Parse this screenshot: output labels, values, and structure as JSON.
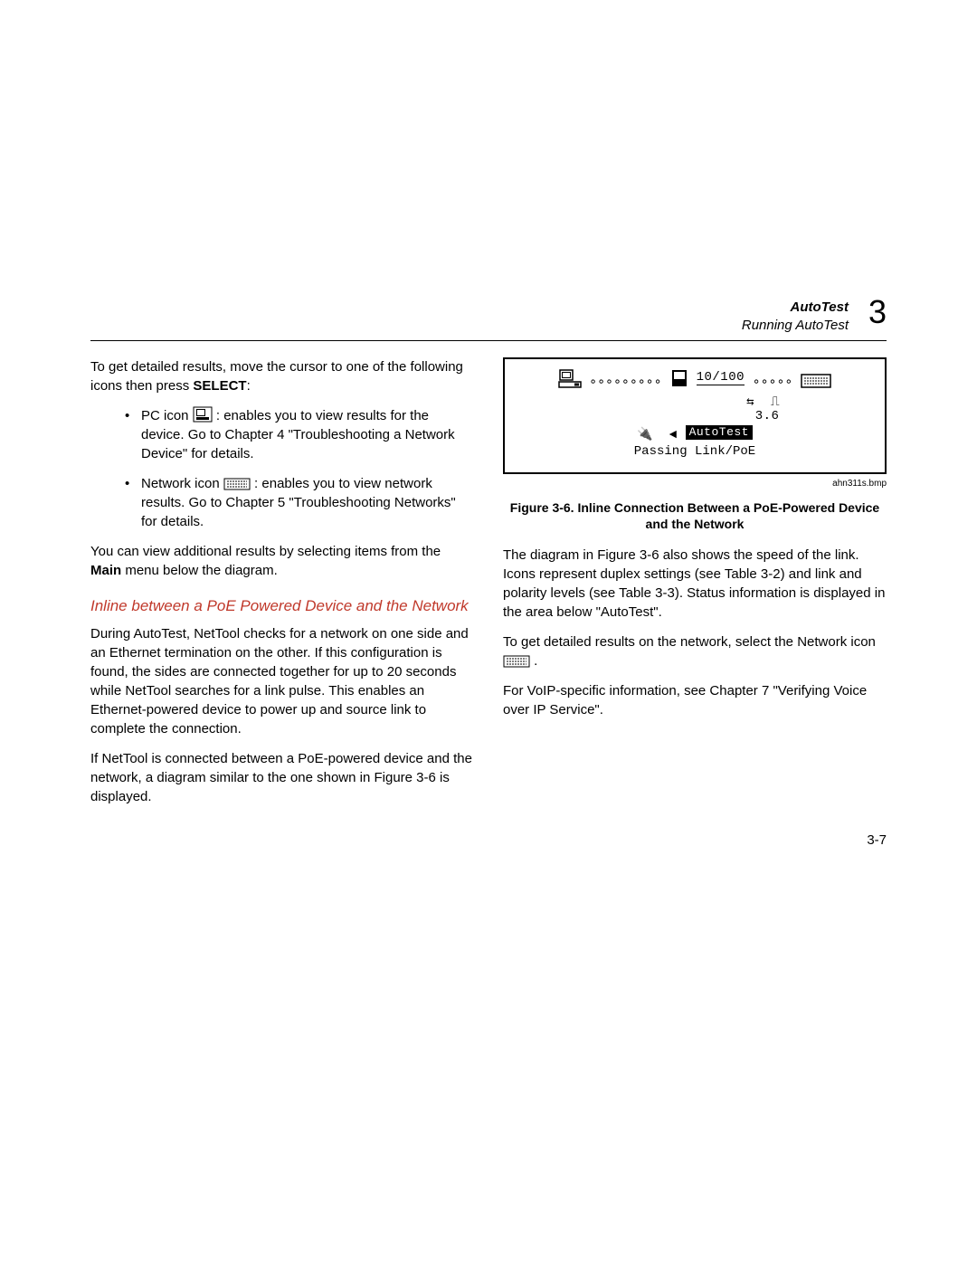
{
  "header": {
    "title": "AutoTest",
    "subtitle": "Running AutoTest",
    "chapter_num": "3"
  },
  "left": {
    "intro": "To get detailed results, move the cursor to one of the following icons then press ",
    "intro_bold": "SELECT",
    "intro_colon": ":",
    "bullet1_a": "PC icon ",
    "bullet1_b": ": enables you to view results for the device. Go to Chapter 4 \"Troubleshooting a Network Device\" for details.",
    "bullet2_a": "Network icon ",
    "bullet2_b": " : enables you to view network results. Go to Chapter 5 \"Troubleshooting Networks\" for details.",
    "after_bullets_a": "You can view additional results by selecting items from the ",
    "after_bullets_bold": "Main",
    "after_bullets_b": " menu below the diagram.",
    "subhead": "Inline between a PoE Powered Device and the Network",
    "p1": "During AutoTest, NetTool checks for a network on one side and an Ethernet termination on the other. If this configuration is found, the sides are connected together for up to 20 seconds while NetTool searches for a link pulse. This enables an Ethernet-powered device to power up and source link to complete the connection.",
    "p2": "If NetTool is connected between a PoE-powered device and the network, a diagram similar to the one shown in Figure 3-6 is displayed."
  },
  "right": {
    "fig_speed": "10/100",
    "fig_val": "3.6",
    "fig_label": "AutoTest",
    "fig_status": "Passing Link/PoE",
    "fig_file": "ahn311s.bmp",
    "fig_caption": "Figure 3-6. Inline Connection Between a PoE-Powered Device and the Network",
    "p1": "The diagram in Figure 3-6 also shows the speed of the link. Icons represent duplex settings (see Table 3-2) and link and polarity levels (see Table 3-3). Status information is displayed in the area below \"AutoTest\".",
    "p2_a": "To get detailed results on the network, select the Network icon ",
    "p2_b": " .",
    "p3": "For VoIP-specific information, see Chapter 7 \"Verifying Voice over IP Service\"."
  },
  "page_num": "3-7"
}
